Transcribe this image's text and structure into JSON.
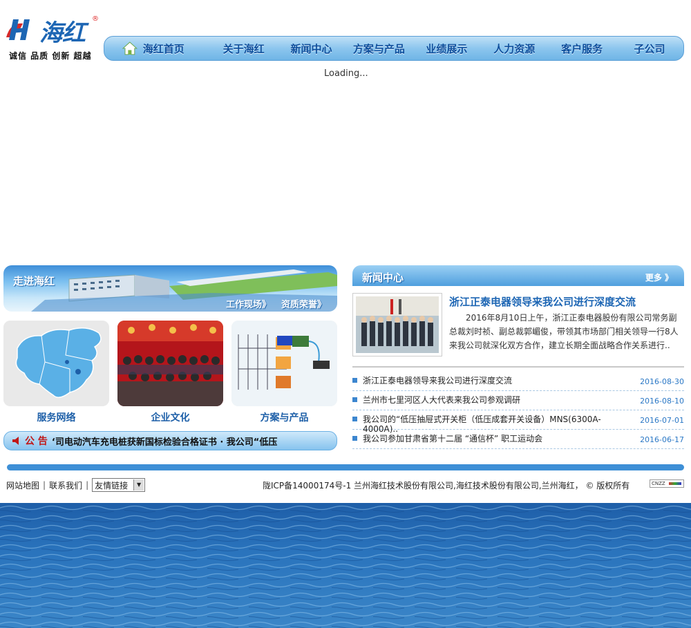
{
  "logo": {
    "brand": "海红",
    "registered": "®",
    "slogan": "诚信 品质 创新 超越"
  },
  "nav": {
    "items": [
      "海红首页",
      "关于海红",
      "新闻中心",
      "方案与产品",
      "业绩展示",
      "人力资源",
      "客户服务",
      "子公司"
    ]
  },
  "loading": "Loading...",
  "about": {
    "title": "走进海红",
    "link1": "工作现场》",
    "link2": "资质荣誉》"
  },
  "cards": [
    {
      "label": "服务网络"
    },
    {
      "label": "企业文化"
    },
    {
      "label": "方案与产品"
    }
  ],
  "notice": {
    "title": "公 告",
    "text": "‘司电动汽车充电桩获新国标检验合格证书      ·  我公司“低压"
  },
  "news": {
    "title": "新闻中心",
    "more": "更多 》",
    "feature": {
      "title": "浙江正泰电器领导来我公司进行深度交流",
      "summary": "2016年8月10日上午，浙江正泰电器股份有限公司常务副总裁刘时祯、副总裁郭嵋俊，带领其市场部门相关领导一行8人来我公司就深化双方合作，建立长期全面战略合作关系进行.."
    },
    "items": [
      {
        "title": "浙江正泰电器领导来我公司进行深度交流",
        "date": "2016-08-30"
      },
      {
        "title": "兰州市七里河区人大代表来我公司参观调研",
        "date": "2016-08-10"
      },
      {
        "title": "我公司的“低压抽屉式开关柜（低压成套开关设备）MNS(6300A-4000A)..",
        "date": "2016-07-01"
      },
      {
        "title": "我公司参加甘肃省第十二届 “通信杯” 职工运动会",
        "date": "2016-06-17"
      }
    ]
  },
  "footer": {
    "sitemap": "网站地图",
    "contact": "联系我们",
    "friend_links": "友情链接",
    "icp_text": "陇ICP备14000174号-1   兰州海红技术股份有限公司,海红技术股份有限公司,兰州海红，  ©   版权所有",
    "cnzz": "CNZZ"
  },
  "colors": {
    "accent": "#3e8fd6",
    "nav_text": "#0d4e9c",
    "notice_red": "#c01818",
    "date_blue": "#2b78c6"
  }
}
